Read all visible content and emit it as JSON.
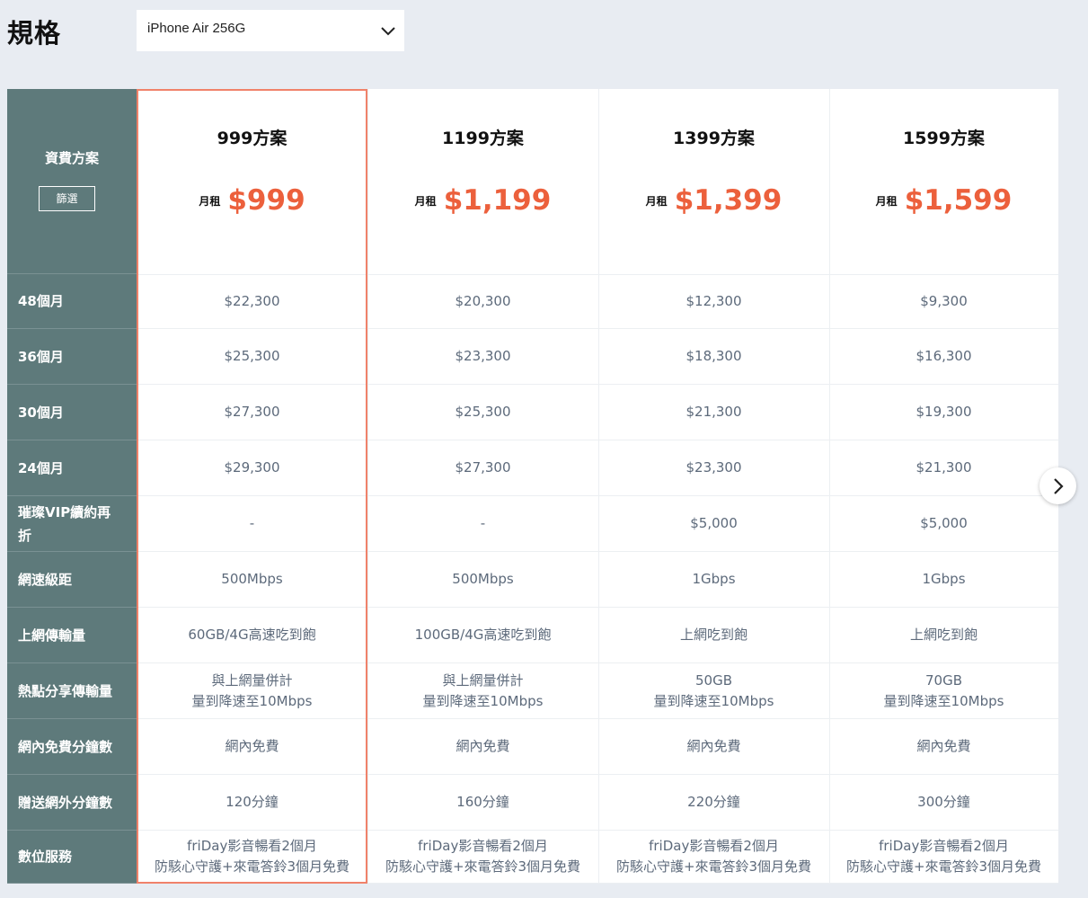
{
  "header": {
    "title": "規格"
  },
  "spec_select": {
    "value": "iPhone Air 256G",
    "icon": "chevron-down-icon"
  },
  "label_column": {
    "title": "資費方案",
    "filter_label": "篩選",
    "rows": [
      {
        "line1": "48個月",
        "line2": ""
      },
      {
        "line1": "36個月",
        "line2": ""
      },
      {
        "line1": "30個月",
        "line2": ""
      },
      {
        "line1": "24個月",
        "line2": ""
      },
      {
        "line1": "璀璨VIP續約再",
        "line2": "折"
      },
      {
        "line1": "網速級距",
        "line2": ""
      },
      {
        "line1": "上網傳輸量",
        "line2": ""
      },
      {
        "line1": "熱點分享傳輸量",
        "line2": ""
      },
      {
        "line1": "網內免費分鐘數",
        "line2": ""
      },
      {
        "line1": "贈送網外分鐘數",
        "line2": ""
      },
      {
        "line1": "數位服務",
        "line2": ""
      }
    ]
  },
  "plans": [
    {
      "name": "999方案",
      "rent_label": "月租",
      "price": "$999",
      "cells": [
        {
          "line1": "$22,300",
          "line2": ""
        },
        {
          "line1": "$25,300",
          "line2": ""
        },
        {
          "line1": "$27,300",
          "line2": ""
        },
        {
          "line1": "$29,300",
          "line2": ""
        },
        {
          "line1": "-",
          "line2": ""
        },
        {
          "line1": "500Mbps",
          "line2": ""
        },
        {
          "line1": "60GB/4G高速吃到飽",
          "line2": ""
        },
        {
          "line1": "與上網量併計",
          "line2": "量到降速至10Mbps"
        },
        {
          "line1": "網內免費",
          "line2": ""
        },
        {
          "line1": "120分鐘",
          "line2": ""
        },
        {
          "line1": "friDay影音暢看2個月",
          "line2": "防駭心守護+來電答鈴3個月免費"
        }
      ]
    },
    {
      "name": "1199方案",
      "rent_label": "月租",
      "price": "$1,199",
      "cells": [
        {
          "line1": "$20,300",
          "line2": ""
        },
        {
          "line1": "$23,300",
          "line2": ""
        },
        {
          "line1": "$25,300",
          "line2": ""
        },
        {
          "line1": "$27,300",
          "line2": ""
        },
        {
          "line1": "-",
          "line2": ""
        },
        {
          "line1": "500Mbps",
          "line2": ""
        },
        {
          "line1": "100GB/4G高速吃到飽",
          "line2": ""
        },
        {
          "line1": "與上網量併計",
          "line2": "量到降速至10Mbps"
        },
        {
          "line1": "網內免費",
          "line2": ""
        },
        {
          "line1": "160分鐘",
          "line2": ""
        },
        {
          "line1": "friDay影音暢看2個月",
          "line2": "防駭心守護+來電答鈴3個月免費"
        }
      ]
    },
    {
      "name": "1399方案",
      "rent_label": "月租",
      "price": "$1,399",
      "cells": [
        {
          "line1": "$12,300",
          "line2": ""
        },
        {
          "line1": "$18,300",
          "line2": ""
        },
        {
          "line1": "$21,300",
          "line2": ""
        },
        {
          "line1": "$23,300",
          "line2": ""
        },
        {
          "line1": "$5,000",
          "line2": ""
        },
        {
          "line1": "1Gbps",
          "line2": ""
        },
        {
          "line1": "上網吃到飽",
          "line2": ""
        },
        {
          "line1": "50GB",
          "line2": "量到降速至10Mbps"
        },
        {
          "line1": "網內免費",
          "line2": ""
        },
        {
          "line1": "220分鐘",
          "line2": ""
        },
        {
          "line1": "friDay影音暢看2個月",
          "line2": "防駭心守護+來電答鈴3個月免費"
        }
      ]
    },
    {
      "name": "1599方案",
      "rent_label": "月租",
      "price": "$1,599",
      "cells": [
        {
          "line1": "$9,300",
          "line2": ""
        },
        {
          "line1": "$16,300",
          "line2": ""
        },
        {
          "line1": "$19,300",
          "line2": ""
        },
        {
          "line1": "$21,300",
          "line2": ""
        },
        {
          "line1": "$5,000",
          "line2": ""
        },
        {
          "line1": "1Gbps",
          "line2": ""
        },
        {
          "line1": "上網吃到飽",
          "line2": ""
        },
        {
          "line1": "70GB",
          "line2": "量到降速至10Mbps"
        },
        {
          "line1": "網內免費",
          "line2": ""
        },
        {
          "line1": "300分鐘",
          "line2": ""
        },
        {
          "line1": "friDay影音暢看2個月",
          "line2": "防駭心守護+來電答鈴3個月免費"
        }
      ]
    }
  ],
  "next_button": {
    "icon": "chevron-right-icon"
  },
  "colors": {
    "accent": "#ec603c",
    "label_bg": "#5e7a7b",
    "highlight_border": "#f0826a",
    "page_bg": "#e8ecf2"
  }
}
